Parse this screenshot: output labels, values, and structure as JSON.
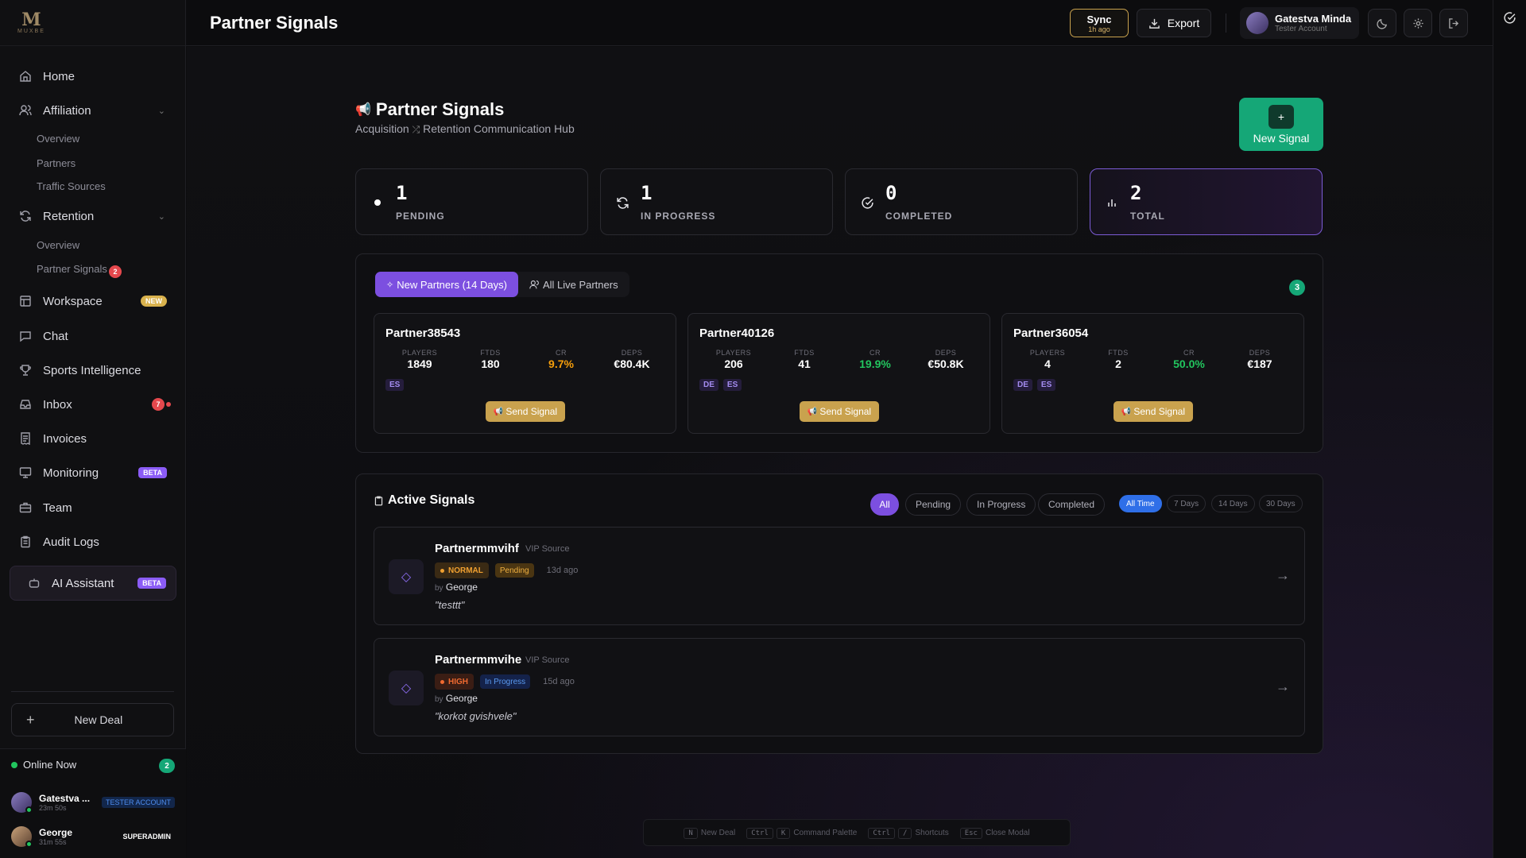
{
  "app": {
    "logo_text": "MUXBE"
  },
  "header": {
    "title": "Partner Signals",
    "sync_label": "Sync",
    "sync_sub": "1h ago",
    "export_label": "Export",
    "user_name": "Gatestva Minda",
    "user_role": "Tester Account"
  },
  "sidebar": {
    "home": "Home",
    "affiliation": "Affiliation",
    "affiliation_sub": [
      "Overview",
      "Partners",
      "Traffic Sources"
    ],
    "retention": "Retention",
    "retention_sub": [
      "Overview",
      "Partner Signals"
    ],
    "partner_signals_badge": "2",
    "workspace": "Workspace",
    "workspace_badge": "NEW",
    "chat": "Chat",
    "sports": "Sports Intelligence",
    "inbox": "Inbox",
    "inbox_badge": "7",
    "invoices": "Invoices",
    "monitoring": "Monitoring",
    "monitoring_badge": "BETA",
    "team": "Team",
    "audit": "Audit Logs",
    "ai": "AI Assistant",
    "ai_badge": "BETA",
    "new_deal": "New Deal",
    "online_label": "Online Now",
    "online_count": "2",
    "online_users": [
      {
        "name": "Gatestva ...",
        "time": "23m 50s",
        "role": "TESTER ACCOUNT"
      },
      {
        "name": "George",
        "time": "31m 55s",
        "role": "SUPERADMIN"
      }
    ]
  },
  "page": {
    "title": "Partner Signals",
    "subtitle_a": "Acquisition",
    "subtitle_b": "Retention Communication Hub",
    "new_signal": "New Signal"
  },
  "stats": [
    {
      "value": "1",
      "label": "PENDING",
      "icon": "dot-icon"
    },
    {
      "value": "1",
      "label": "IN PROGRESS",
      "icon": "refresh-icon"
    },
    {
      "value": "0",
      "label": "COMPLETED",
      "icon": "check-circle-icon"
    },
    {
      "value": "2",
      "label": "TOTAL",
      "icon": "bar-chart-icon"
    }
  ],
  "partners_panel": {
    "tab_new": "New Partners (14 Days)",
    "tab_live": "All Live Partners",
    "count": "3",
    "metric_labels": [
      "PLAYERS",
      "FTDS",
      "CR",
      "DEPS"
    ],
    "send_label": "Send Signal",
    "cards": [
      {
        "name": "Partner38543",
        "players": "1849",
        "ftds": "180",
        "cr": "9.7%",
        "cr_color": "#f59e0b",
        "deps": "€80.4K",
        "tags": [
          "ES"
        ]
      },
      {
        "name": "Partner40126",
        "players": "206",
        "ftds": "41",
        "cr": "19.9%",
        "cr_color": "#22c55e",
        "deps": "€50.8K",
        "tags": [
          "DE",
          "ES"
        ]
      },
      {
        "name": "Partner36054",
        "players": "4",
        "ftds": "2",
        "cr": "50.0%",
        "cr_color": "#22c55e",
        "deps": "€187",
        "tags": [
          "DE",
          "ES"
        ]
      }
    ]
  },
  "active_signals": {
    "title": "Active Signals",
    "status_filters": [
      "All",
      "Pending",
      "In Progress",
      "Completed"
    ],
    "time_filters": [
      "All Time",
      "7 Days",
      "14 Days",
      "30 Days"
    ],
    "by_prefix": "by",
    "items": [
      {
        "name": "Partnermmvihf",
        "source": "VIP Source",
        "priority": "NORMAL",
        "status": "Pending",
        "ago": "13d ago",
        "by": "George",
        "message": "\"testtt\""
      },
      {
        "name": "Partnermmvihe",
        "source": "VIP Source",
        "priority": "HIGH",
        "status": "In Progress",
        "ago": "15d ago",
        "by": "George",
        "message": "\"korkot gvishvele\""
      }
    ]
  },
  "shortcuts": [
    {
      "keys": [
        "N"
      ],
      "label": "New Deal"
    },
    {
      "keys": [
        "Ctrl",
        "K"
      ],
      "label": "Command Palette"
    },
    {
      "keys": [
        "Ctrl",
        "/"
      ],
      "label": "Shortcuts"
    },
    {
      "keys": [
        "Esc"
      ],
      "label": "Close Modal"
    }
  ],
  "colors": {
    "accent": "#7c4fe0",
    "green": "#15a777",
    "gold": "#c9a24e"
  }
}
